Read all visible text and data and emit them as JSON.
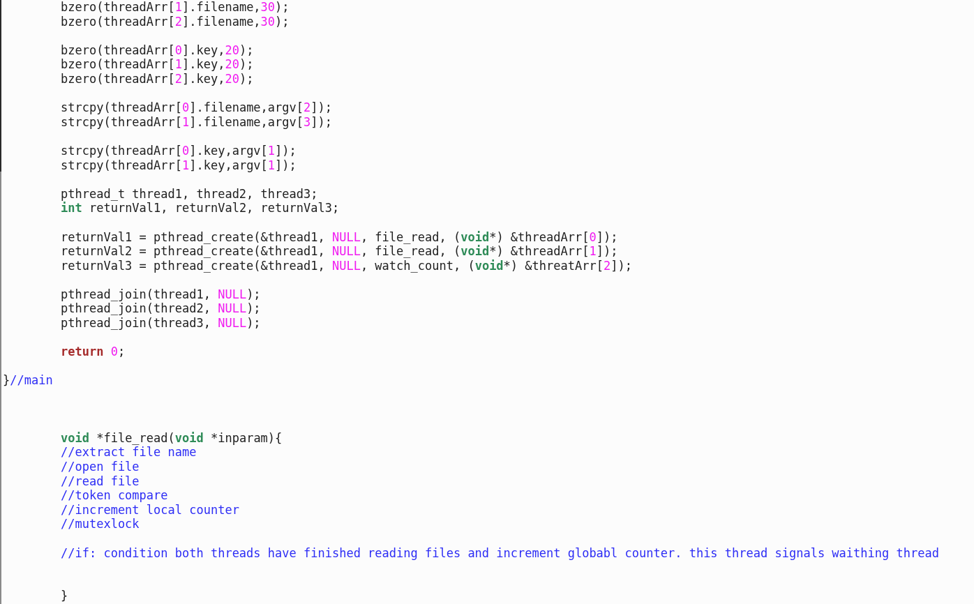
{
  "editor": {
    "lines": [
      {
        "kind": "code",
        "tokens": [
          {
            "kind": "plain",
            "text": "bzero(threadArr["
          },
          {
            "kind": "number",
            "text": "1"
          },
          {
            "kind": "plain",
            "text": "].filename,"
          },
          {
            "kind": "number",
            "text": "30"
          },
          {
            "kind": "plain",
            "text": ");"
          }
        ]
      },
      {
        "kind": "code",
        "tokens": [
          {
            "kind": "plain",
            "text": "bzero(threadArr["
          },
          {
            "kind": "number",
            "text": "2"
          },
          {
            "kind": "plain",
            "text": "].filename,"
          },
          {
            "kind": "number",
            "text": "30"
          },
          {
            "kind": "plain",
            "text": ");"
          }
        ]
      },
      {
        "kind": "blank"
      },
      {
        "kind": "code",
        "tokens": [
          {
            "kind": "plain",
            "text": "bzero(threadArr["
          },
          {
            "kind": "number",
            "text": "0"
          },
          {
            "kind": "plain",
            "text": "].key,"
          },
          {
            "kind": "number",
            "text": "20"
          },
          {
            "kind": "plain",
            "text": ");"
          }
        ]
      },
      {
        "kind": "code",
        "tokens": [
          {
            "kind": "plain",
            "text": "bzero(threadArr["
          },
          {
            "kind": "number",
            "text": "1"
          },
          {
            "kind": "plain",
            "text": "].key,"
          },
          {
            "kind": "number",
            "text": "20"
          },
          {
            "kind": "plain",
            "text": ");"
          }
        ]
      },
      {
        "kind": "code",
        "tokens": [
          {
            "kind": "plain",
            "text": "bzero(threadArr["
          },
          {
            "kind": "number",
            "text": "2"
          },
          {
            "kind": "plain",
            "text": "].key,"
          },
          {
            "kind": "number",
            "text": "20"
          },
          {
            "kind": "plain",
            "text": ");"
          }
        ]
      },
      {
        "kind": "blank"
      },
      {
        "kind": "code",
        "tokens": [
          {
            "kind": "plain",
            "text": "strcpy(threadArr["
          },
          {
            "kind": "number",
            "text": "0"
          },
          {
            "kind": "plain",
            "text": "].filename,argv["
          },
          {
            "kind": "number",
            "text": "2"
          },
          {
            "kind": "plain",
            "text": "]);"
          }
        ]
      },
      {
        "kind": "code",
        "tokens": [
          {
            "kind": "plain",
            "text": "strcpy(threadArr["
          },
          {
            "kind": "number",
            "text": "1"
          },
          {
            "kind": "plain",
            "text": "].filename,argv["
          },
          {
            "kind": "number",
            "text": "3"
          },
          {
            "kind": "plain",
            "text": "]);"
          }
        ]
      },
      {
        "kind": "blank"
      },
      {
        "kind": "code",
        "tokens": [
          {
            "kind": "plain",
            "text": "strcpy(threadArr["
          },
          {
            "kind": "number",
            "text": "0"
          },
          {
            "kind": "plain",
            "text": "].key,argv["
          },
          {
            "kind": "number",
            "text": "1"
          },
          {
            "kind": "plain",
            "text": "]);"
          }
        ]
      },
      {
        "kind": "code",
        "tokens": [
          {
            "kind": "plain",
            "text": "strcpy(threadArr["
          },
          {
            "kind": "number",
            "text": "1"
          },
          {
            "kind": "plain",
            "text": "].key,argv["
          },
          {
            "kind": "number",
            "text": "1"
          },
          {
            "kind": "plain",
            "text": "]);"
          }
        ]
      },
      {
        "kind": "blank"
      },
      {
        "kind": "code",
        "tokens": [
          {
            "kind": "plain",
            "text": "pthread_t thread1, thread2, thread3;"
          }
        ]
      },
      {
        "kind": "code",
        "tokens": [
          {
            "kind": "type",
            "text": "int"
          },
          {
            "kind": "plain",
            "text": " returnVal1, returnVal2, returnVal3;"
          }
        ]
      },
      {
        "kind": "blank"
      },
      {
        "kind": "code",
        "tokens": [
          {
            "kind": "plain",
            "text": "returnVal1 = pthread_create(&thread1, "
          },
          {
            "kind": "number",
            "text": "NULL"
          },
          {
            "kind": "plain",
            "text": ", file_read, ("
          },
          {
            "kind": "type",
            "text": "void"
          },
          {
            "kind": "plain",
            "text": "*) &threadArr["
          },
          {
            "kind": "number",
            "text": "0"
          },
          {
            "kind": "plain",
            "text": "]);"
          }
        ]
      },
      {
        "kind": "code",
        "tokens": [
          {
            "kind": "plain",
            "text": "returnVal2 = pthread_create(&thread1, "
          },
          {
            "kind": "number",
            "text": "NULL"
          },
          {
            "kind": "plain",
            "text": ", file_read, ("
          },
          {
            "kind": "type",
            "text": "void"
          },
          {
            "kind": "plain",
            "text": "*) &threadArr["
          },
          {
            "kind": "number",
            "text": "1"
          },
          {
            "kind": "plain",
            "text": "]);"
          }
        ]
      },
      {
        "kind": "code",
        "tokens": [
          {
            "kind": "plain",
            "text": "returnVal3 = pthread_create(&thread1, "
          },
          {
            "kind": "number",
            "text": "NULL"
          },
          {
            "kind": "plain",
            "text": ", watch_count, ("
          },
          {
            "kind": "type",
            "text": "void"
          },
          {
            "kind": "plain",
            "text": "*) &threatArr["
          },
          {
            "kind": "number",
            "text": "2"
          },
          {
            "kind": "plain",
            "text": "]);"
          }
        ]
      },
      {
        "kind": "blank"
      },
      {
        "kind": "code",
        "tokens": [
          {
            "kind": "plain",
            "text": "pthread_join(thread1, "
          },
          {
            "kind": "number",
            "text": "NULL"
          },
          {
            "kind": "plain",
            "text": ");"
          }
        ]
      },
      {
        "kind": "code",
        "tokens": [
          {
            "kind": "plain",
            "text": "pthread_join(thread2, "
          },
          {
            "kind": "number",
            "text": "NULL"
          },
          {
            "kind": "plain",
            "text": ");"
          }
        ]
      },
      {
        "kind": "code",
        "tokens": [
          {
            "kind": "plain",
            "text": "pthread_join(thread3, "
          },
          {
            "kind": "number",
            "text": "NULL"
          },
          {
            "kind": "plain",
            "text": ");"
          }
        ]
      },
      {
        "kind": "blank"
      },
      {
        "kind": "code",
        "tokens": [
          {
            "kind": "keyword",
            "text": "return "
          },
          {
            "kind": "number",
            "text": "0"
          },
          {
            "kind": "plain",
            "text": ";"
          }
        ]
      },
      {
        "kind": "blank"
      },
      {
        "kind": "flush",
        "tokens": [
          {
            "kind": "plain",
            "text": "}"
          },
          {
            "kind": "comment",
            "text": "//main"
          }
        ]
      },
      {
        "kind": "blank"
      },
      {
        "kind": "blank"
      },
      {
        "kind": "blank"
      },
      {
        "kind": "code",
        "tokens": [
          {
            "kind": "type",
            "text": "void"
          },
          {
            "kind": "plain",
            "text": " *file_read("
          },
          {
            "kind": "type",
            "text": "void"
          },
          {
            "kind": "plain",
            "text": " *inparam){"
          }
        ]
      },
      {
        "kind": "code",
        "tokens": [
          {
            "kind": "comment",
            "text": "//extract file name"
          }
        ]
      },
      {
        "kind": "code",
        "tokens": [
          {
            "kind": "comment",
            "text": "//open file"
          }
        ]
      },
      {
        "kind": "code",
        "tokens": [
          {
            "kind": "comment",
            "text": "//read file"
          }
        ]
      },
      {
        "kind": "code",
        "tokens": [
          {
            "kind": "comment",
            "text": "//token compare"
          }
        ]
      },
      {
        "kind": "code",
        "tokens": [
          {
            "kind": "comment",
            "text": "//increment local counter"
          }
        ]
      },
      {
        "kind": "code",
        "tokens": [
          {
            "kind": "comment",
            "text": "//mutexlock"
          }
        ]
      },
      {
        "kind": "blank"
      },
      {
        "kind": "code",
        "tokens": [
          {
            "kind": "comment",
            "text": "//if: condition both threads have finished reading files and increment globabl counter. this thread signals waithing thread"
          }
        ]
      },
      {
        "kind": "blank"
      },
      {
        "kind": "blank"
      },
      {
        "kind": "code",
        "tokens": [
          {
            "kind": "plain",
            "text": "}"
          }
        ]
      }
    ]
  }
}
